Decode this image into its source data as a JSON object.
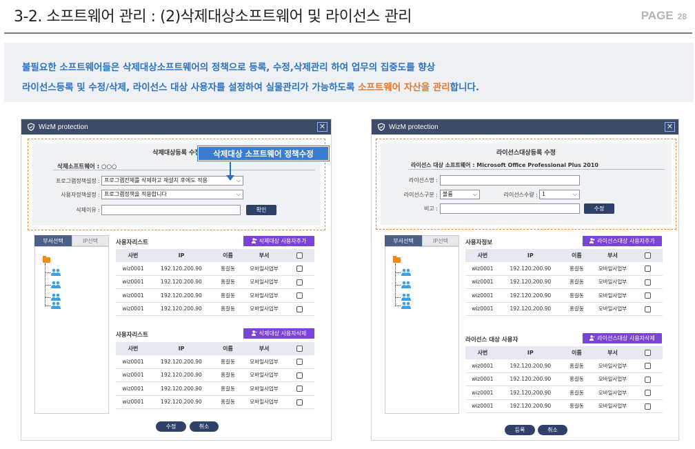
{
  "header": {
    "title": "3-2. 소프트웨어 관리 : (2)삭제대상소프트웨어 및 라이선스 관리",
    "page_label": "PAGE",
    "page_number": "28"
  },
  "banner": {
    "line1": "불필요한 소프트웨어들은 삭제대상소프트웨어의 정책으로 등록, 수정,삭제관리 하여 업무의 집중도를 향상",
    "line2_prefix": "라이선스등록 및 수정/삭제, 라이선스 대상 사용자를 설정하여  실물관리가 가능하도록 ",
    "line2_highlight": "소프트웨어 자산을 관리",
    "line2_suffix": "합니다."
  },
  "left_window": {
    "app_title": "WizM protection",
    "form_title": "삭제대상등록 수정",
    "callout": "삭제대상 소프트웨어 정책수정",
    "software_label": "삭제소프트웨어 : ○○○",
    "program_policy_label": "프로그램정책설정 :",
    "program_policy_value": "프로그램전체를 삭제하고 재설치 후에도 적용",
    "user_policy_label": "사용자정책설정 :",
    "user_policy_value": "프로그램정책을 적용합니다",
    "reason_label": "삭제이유 :",
    "reason_value": "",
    "confirm_label": "확인",
    "tab_dept": "부서선택",
    "tab_ip": "IP선택",
    "list1_title": "사용자리스트",
    "list1_button": "삭제대상 사용자추가",
    "list2_title": "사용자리스트",
    "list2_button": "삭제대상 사용자삭제",
    "edit_label": "수정",
    "cancel_label": "취소"
  },
  "right_window": {
    "app_title": "WizM protection",
    "form_title": "라이선스대상등록 수정",
    "software_label": "라이선스 대상 소프트웨어 : Microsoft Office Professional Plus 2010",
    "license_name_label": "라이선스명 :",
    "license_name_value": "",
    "license_type_label": "라이선스구분 :",
    "license_type_value": "볼륨",
    "license_count_label": "라이선스수량 :",
    "license_count_value": "1",
    "note_label": "비고 :",
    "note_value": "",
    "edit_label": "수정",
    "tab_dept": "부서선택",
    "tab_ip": "IP선택",
    "list1_title": "사용자정보",
    "list1_button": "라이선스대상 사용자추가",
    "list2_title": "라이선스 대상 사용자",
    "list2_button": "라이선스대상 사용자삭제",
    "register_label": "등록",
    "cancel_label": "취소"
  },
  "table_headers": [
    "사번",
    "IP",
    "이름",
    "부서"
  ],
  "rows": [
    {
      "id": "wiz0001",
      "ip": "192.120.200.90",
      "name": "홍길동",
      "dept": "모바일사업부"
    },
    {
      "id": "wiz0001",
      "ip": "192.120.200.90",
      "name": "홍길동",
      "dept": "모바일사업부"
    },
    {
      "id": "wiz0001",
      "ip": "192.120.200.90",
      "name": "홍길동",
      "dept": "모바일사업부"
    },
    {
      "id": "wiz0001",
      "ip": "192.120.200.90",
      "name": "홍길동",
      "dept": "모바일사업부"
    }
  ],
  "colors": {
    "accent_blue": "#2e73c0",
    "accent_orange": "#e5782c",
    "navy": "#2f4169",
    "purple": "#7b43d6"
  }
}
